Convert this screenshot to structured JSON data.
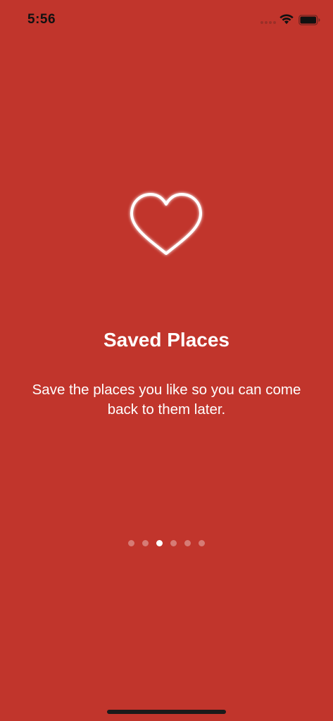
{
  "status_bar": {
    "time": "5:56",
    "icons": [
      "cellular-signal-icon",
      "wifi-icon",
      "battery-icon"
    ]
  },
  "onboarding": {
    "icon": "heart-outline-icon",
    "title": "Saved Places",
    "description": "Save the places you like so you can come back to them later."
  },
  "page_indicator": {
    "total_pages": 6,
    "current_page": 3
  },
  "colors": {
    "background": "#c1352c",
    "text": "#ffffff",
    "status_text": "#111111",
    "dot_inactive": "rgba(255,255,255,0.35)",
    "dot_active": "#ffffff"
  }
}
